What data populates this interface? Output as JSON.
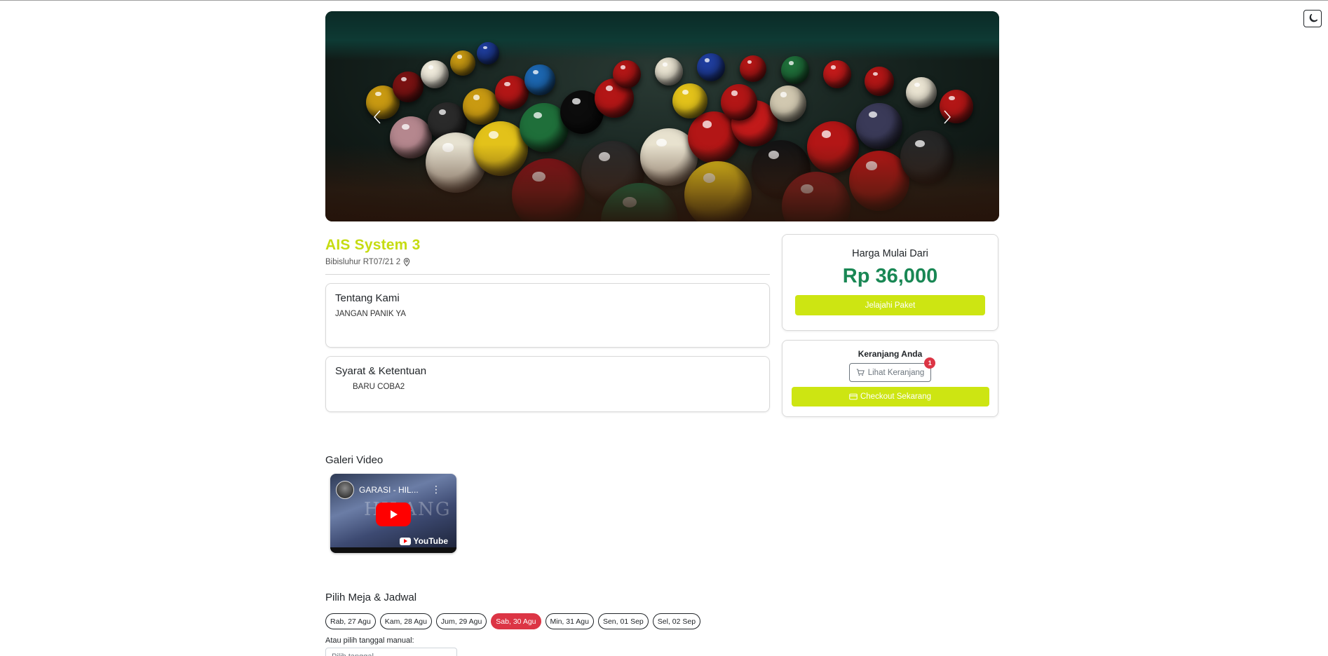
{
  "theme_toggle": {
    "icon": "moon-icon"
  },
  "carousel": {
    "prev_icon": "chevron-left-icon",
    "next_icon": "chevron-right-icon",
    "image": "billiard-balls-photo"
  },
  "venue": {
    "name": "AIS System 3",
    "address": "Bibisluhur RT07/21 2",
    "address_icon": "map-pin-icon"
  },
  "about": {
    "title": "Tentang Kami",
    "text": "JANGAN PANIK YA"
  },
  "terms": {
    "title": "Syarat & Ketentuan",
    "text": "BARU COBA2"
  },
  "pricing": {
    "label": "Harga Mulai Dari",
    "price": "Rp 36,000",
    "explore_button": "Jelajahi Paket"
  },
  "cart": {
    "title": "Keranjang Anda",
    "view_button": "Lihat Keranjang",
    "badge_count": "1",
    "checkout_button": "Checkout Sekarang",
    "colors": {
      "accent": "#cde512",
      "badge": "#dc3545"
    }
  },
  "video_gallery": {
    "title": "Galeri Video",
    "video_title": "GARASI - HIL...",
    "thumbnail_text": "HILANG",
    "platform": "YouTube"
  },
  "schedule": {
    "title": "Pilih Meja & Jadwal",
    "dates": [
      {
        "label": "Rab, 27 Agu",
        "active": false
      },
      {
        "label": "Kam, 28 Agu",
        "active": false
      },
      {
        "label": "Jum, 29 Agu",
        "active": false
      },
      {
        "label": "Sab, 30 Agu",
        "active": true
      },
      {
        "label": "Min, 31 Agu",
        "active": false
      },
      {
        "label": "Sen, 01 Sep",
        "active": false
      },
      {
        "label": "Sel, 02 Sep",
        "active": false
      }
    ],
    "manual_label": "Atau pilih tanggal manual:",
    "date_placeholder": "Pilih tanggal..."
  }
}
